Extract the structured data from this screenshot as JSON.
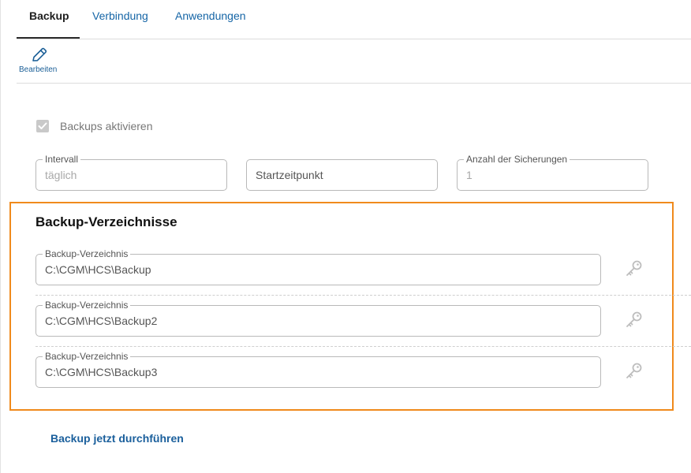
{
  "tabs": [
    {
      "label": "Backup",
      "active": true
    },
    {
      "label": "Verbindung",
      "active": false
    },
    {
      "label": "Anwendungen",
      "active": false
    }
  ],
  "toolbar": {
    "edit_label": "Bearbeiten",
    "edit_icon": "pencil-icon"
  },
  "settings": {
    "enable_label": "Backups aktivieren",
    "enable_checked": true,
    "interval": {
      "label": "Intervall",
      "value": "täglich"
    },
    "start_time": {
      "placeholder": "Startzeitpunkt"
    },
    "count": {
      "label": "Anzahl der Sicherungen",
      "value": "1"
    }
  },
  "directories": {
    "title": "Backup-Verzeichnisse",
    "items": [
      {
        "label": "Backup-Verzeichnis",
        "value": "C:\\CGM\\HCS\\Backup",
        "icon": "key-icon"
      },
      {
        "label": "Backup-Verzeichnis",
        "value": "C:\\CGM\\HCS\\Backup2",
        "icon": "key-icon"
      },
      {
        "label": "Backup-Verzeichnis",
        "value": "C:\\CGM\\HCS\\Backup3",
        "icon": "key-icon"
      }
    ]
  },
  "actions": {
    "run_now": "Backup jetzt durchführen"
  },
  "colors": {
    "link": "#1565a6",
    "highlight": "#f08a1c",
    "border": "#b9b9b9"
  }
}
